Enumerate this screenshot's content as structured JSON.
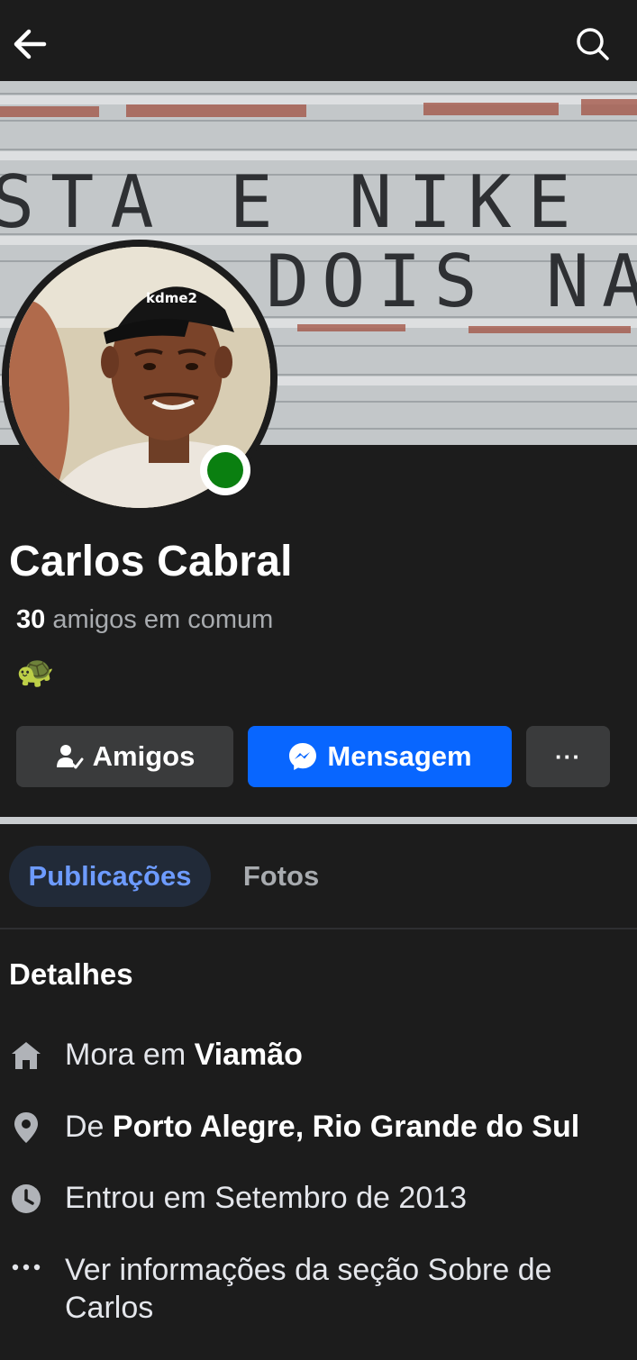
{
  "topbar": {
    "back_icon": "arrow-left-icon",
    "search_icon": "search-icon"
  },
  "cover": {
    "graffiti_line1": "STA E NIKE",
    "graffiti_line2": "DOIS NA"
  },
  "avatar": {
    "cap_text": "kdme2"
  },
  "profile": {
    "name": "Carlos Cabral",
    "mutual_count": "30",
    "mutual_label": " amigos em comum",
    "emoji": "🐢",
    "status_color": "#0a7f10"
  },
  "actions": {
    "friends_label": "Amigos",
    "message_label": "Mensagem",
    "more_label": "···"
  },
  "tabs": [
    {
      "label": "Publicações",
      "active": true
    },
    {
      "label": "Fotos",
      "active": false
    }
  ],
  "details": {
    "title": "Detalhes",
    "lives_prefix": "Mora em ",
    "lives_place": "Viamão",
    "from_prefix": "De ",
    "from_place": "Porto Alegre, Rio Grande do Sul",
    "joined": "Entrou em Setembro de 2013",
    "about_link": "Ver informações da seção Sobre de Carlos"
  },
  "colors": {
    "background": "#1c1c1c",
    "primary_button": "#0866ff",
    "secondary_button": "#3a3b3c",
    "active_tab_text": "#6d9bff"
  }
}
